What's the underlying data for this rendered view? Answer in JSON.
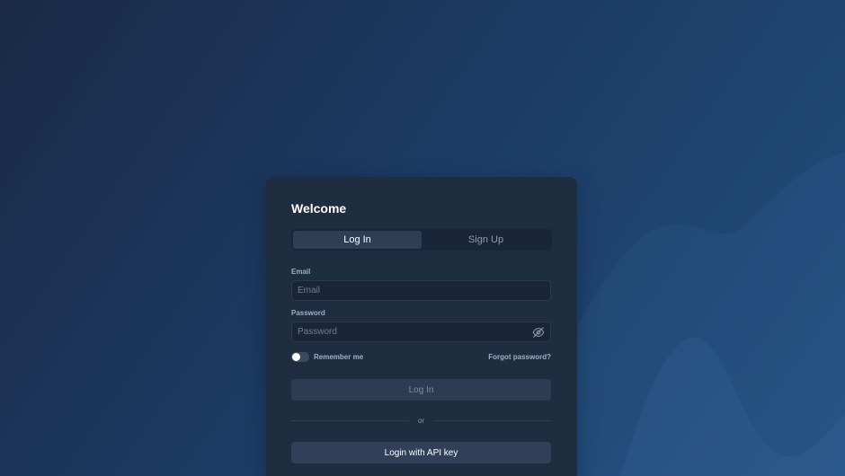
{
  "card": {
    "title": "Welcome"
  },
  "tabs": [
    {
      "label": "Log In",
      "active": true
    },
    {
      "label": "Sign Up",
      "active": false
    }
  ],
  "email": {
    "label": "Email",
    "placeholder": "Email",
    "value": ""
  },
  "password": {
    "label": "Password",
    "placeholder": "Password",
    "value": "",
    "visibility_icon": "eye-off-icon"
  },
  "remember": {
    "label": "Remember me",
    "checked": false
  },
  "forgot": {
    "label": "Forgot password?"
  },
  "login_button": {
    "label": "Log In"
  },
  "divider": {
    "label": "or"
  },
  "api_button": {
    "label": "Login with API key"
  },
  "colors": {
    "background_start": "#1a2a45",
    "background_end": "#21507f",
    "card": "#1f2d40",
    "tab_active": "#2d3e55",
    "button": "#2f4058"
  }
}
